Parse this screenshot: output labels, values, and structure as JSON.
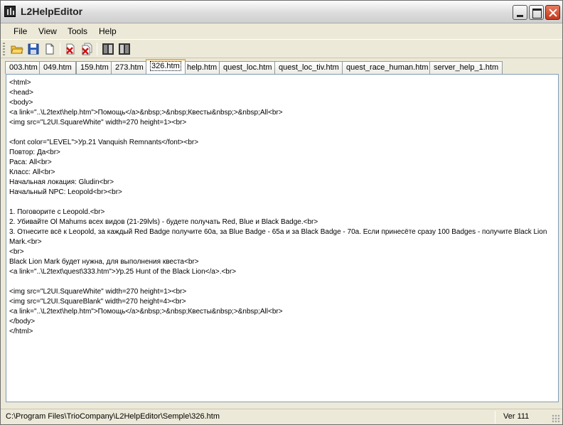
{
  "window": {
    "title": "L2HelpEditor"
  },
  "menu": [
    "File",
    "View",
    "Tools",
    "Help"
  ],
  "toolbar": {
    "icons": [
      "open-folder-icon",
      "save-icon",
      "new-file-icon",
      "delete-icon",
      "delete-all-icon",
      "view-left-icon",
      "view-right-icon"
    ]
  },
  "tabs": [
    {
      "label": "003.htm"
    },
    {
      "label": "049.htm"
    },
    {
      "label": "159.htm"
    },
    {
      "label": "273.htm"
    },
    {
      "label": "326.htm"
    },
    {
      "label": "help.htm"
    },
    {
      "label": "quest_loc.htm"
    },
    {
      "label": "quest_loc_tiv.htm"
    },
    {
      "label": "quest_race_human.htm"
    },
    {
      "label": "server_help_1.htm"
    }
  ],
  "active_tab": "326.htm",
  "editor": {
    "content": "<html>\n<head>\n<body>\n<a link=\"..\\L2text\\help.htm\">Помощь</a>&nbsp;>&nbsp;Квесты&nbsp;>&nbsp;All<br>\n<img src=\"L2UI.SquareWhite\" width=270 height=1><br>\n\n<font color=\"LEVEL\">Ур.21 Vanquish Remnants</font><br>\nПовтор: Да<br>\nРаса: All<br>\nКласс: All<br>\nНачальная локация: Gludin<br>\nНачальный NPC: Leopold<br><br>\n\n1. Поговорите с Leopold.<br>\n2. Убивайте Ol Mahums всех видов (21-29lvls) - будете получать Red, Blue и Black Badge.<br>\n3. Отнесите всё к Leopold, за каждый Red Badge получите 60a, за Blue Badge - 65a и за Black Badge - 70a. Если принесёте сразу 100 Badges - получите Black Lion Mark.<br>\n<br>\nBlack Lion Mark будет нужна, для выполнения квеста<br>\n<a link=\"..\\L2text\\quest\\333.htm\">Ур.25 Hunt of the Black Lion</a>.<br>\n\n<img src=\"L2UI.SquareWhite\" width=270 height=1><br>\n<img src=\"L2UI.SquareBlank\" width=270 height=4><br>\n<a link=\"..\\L2text\\help.htm\">Помощь</a>&nbsp;>&nbsp;Квесты&nbsp;>&nbsp;All<br>\n</body>\n</html>"
  },
  "status": {
    "path": "C:\\Program Files\\TrioCompany\\L2HelpEditor\\Semple\\326.htm",
    "version": "Ver 111"
  }
}
